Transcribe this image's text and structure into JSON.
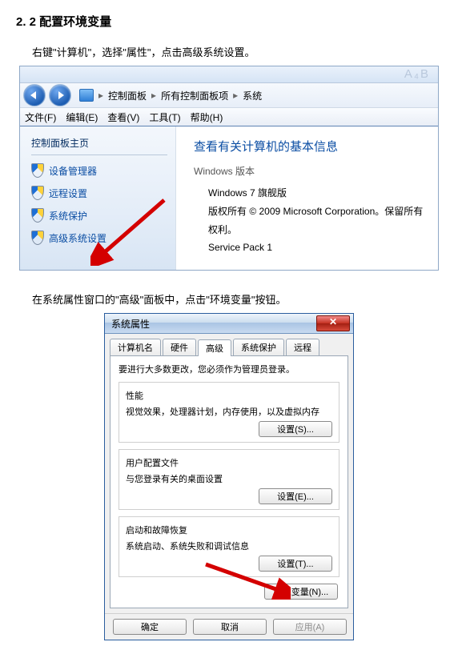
{
  "heading": "2. 2 配置环境变量",
  "para1": "右键\"计算机\"，选择\"属性\"，点击高级系统设置。",
  "para2": "在系统属性窗口的\"高级\"面板中，点击\"环境变量\"按钮。",
  "win7": {
    "doc_title_decor": "A_B",
    "breadcrumb": {
      "root": "控制面板",
      "mid": "所有控制面板项",
      "leaf": "系统"
    },
    "menu": {
      "file": "文件(F)",
      "edit": "编辑(E)",
      "view": "查看(V)",
      "tools": "工具(T)",
      "help": "帮助(H)"
    },
    "sidebar": {
      "title": "控制面板主页",
      "items": [
        "设备管理器",
        "远程设置",
        "系统保护",
        "高级系统设置"
      ]
    },
    "main": {
      "heading": "查看有关计算机的基本信息",
      "section": "Windows 版本",
      "line1": "Windows 7 旗舰版",
      "line2": "版权所有 © 2009 Microsoft Corporation。保留所有权利。",
      "line3": "Service Pack 1"
    }
  },
  "dlg": {
    "title": "系统属性",
    "close_glyph": "✕",
    "tabs": [
      "计算机名",
      "硬件",
      "高级",
      "系统保护",
      "远程"
    ],
    "active_tab_index": 2,
    "admin_note": "要进行大多数更改，您必须作为管理员登录。",
    "perf": {
      "title": "性能",
      "desc": "视觉效果，处理器计划，内存使用，以及虚拟内存",
      "btn": "设置(S)..."
    },
    "profile": {
      "title": "用户配置文件",
      "desc": "与您登录有关的桌面设置",
      "btn": "设置(E)..."
    },
    "startup": {
      "title": "启动和故障恢复",
      "desc": "系统启动、系统失败和调试信息",
      "btn": "设置(T)..."
    },
    "env_btn": "环境变量(N)...",
    "ok": "确定",
    "cancel": "取消",
    "apply": "应用(A)"
  }
}
